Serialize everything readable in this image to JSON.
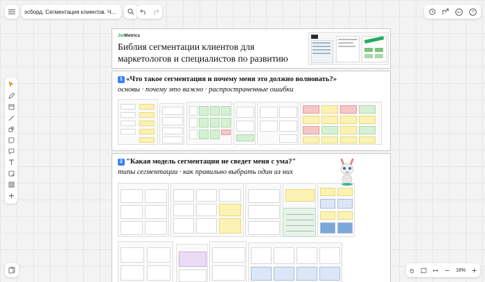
{
  "toolbar": {
    "board_title": "эсборд. Сегментация клиентов. Часть …",
    "zoom": "16%"
  },
  "header": {
    "brand_prefix": "Jet",
    "brand_suffix": "Metrics",
    "title": "Библия сегментации клиентов для маркетологов и специалистов по развитию"
  },
  "section1": {
    "number": "1",
    "title": "«Что такое сегментация и почему меня это должно волновать?»",
    "subtitle": "основы · почему это важно · распространенные ошибки"
  },
  "section2": {
    "number": "2",
    "title": "\"Какая модель сегментации не сведет меня с ума?\"",
    "subtitle": "типы сегментации · как правильно выбрать один из них"
  },
  "icons": {
    "left_toolbar": [
      "cursor-icon",
      "pen-icon",
      "frame-icon",
      "line-icon",
      "shapes-icon",
      "sticky-note-icon",
      "comment-icon",
      "text-icon",
      "sticker-icon",
      "table-icon",
      "plus-icon"
    ],
    "right_tools": [
      "timer-icon",
      "share-icon",
      "avatar-icon",
      "help-icon"
    ],
    "bottom_right": [
      "hand-icon",
      "map-icon",
      "fit-icon",
      "zoom-out-icon",
      "zoom-in-icon"
    ]
  }
}
